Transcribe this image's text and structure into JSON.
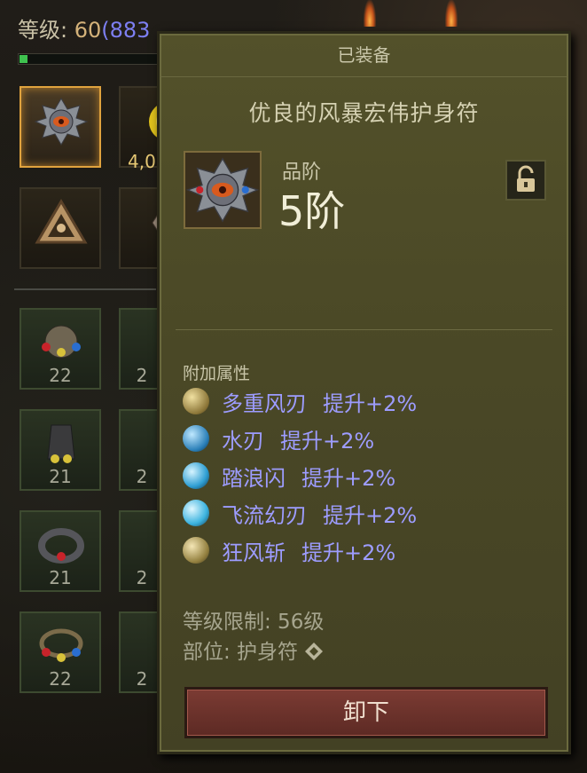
{
  "player": {
    "level_label": "等级:",
    "level_value": "60",
    "paragon": "(883",
    "xp_progress": 0.06
  },
  "inventory": {
    "gold_count": "4,0",
    "slots": [
      {
        "name": "amulet-slot",
        "num": ""
      },
      {
        "name": "gold-slot",
        "num": ""
      },
      {
        "name": "rune-slot",
        "num": ""
      },
      {
        "name": "relic-slot",
        "num": ""
      },
      {
        "name": "item-slot-1",
        "num": "22"
      },
      {
        "name": "item-slot-2",
        "num": "2"
      },
      {
        "name": "item-slot-3",
        "num": "21"
      },
      {
        "name": "item-slot-4",
        "num": "2"
      },
      {
        "name": "item-slot-5",
        "num": "21"
      },
      {
        "name": "item-slot-6",
        "num": "2"
      },
      {
        "name": "item-slot-7",
        "num": "22"
      },
      {
        "name": "item-slot-8",
        "num": "2"
      }
    ]
  },
  "tooltip": {
    "header": "已装备",
    "item_name": "优良的风暴宏伟护身符",
    "tier_label": "品阶",
    "tier_value": "5阶",
    "section_title": "附加属性",
    "stats": [
      {
        "skill": "多重风刃",
        "bonus": "提升+2%",
        "icon": "gold-orb-icon",
        "color": "#c8b36a"
      },
      {
        "skill": "水刃",
        "bonus": "提升+2%",
        "icon": "water-orb-icon",
        "color": "#3fa2d6"
      },
      {
        "skill": "踏浪闪",
        "bonus": "提升+2%",
        "icon": "wave-orb-icon",
        "color": "#49b7e0"
      },
      {
        "skill": "飞流幻刃",
        "bonus": "提升+2%",
        "icon": "flow-orb-icon",
        "color": "#4fc0e8"
      },
      {
        "skill": "狂风斩",
        "bonus": "提升+2%",
        "icon": "wind-orb-icon",
        "color": "#c7b06c"
      }
    ],
    "level_req": "等级限制: 56级",
    "slot_type": "部位: 护身符",
    "unequip_label": "卸下"
  },
  "colors": {
    "panel": "#4b4926",
    "stat_text": "#9d9cff",
    "button": "#6e342d"
  }
}
